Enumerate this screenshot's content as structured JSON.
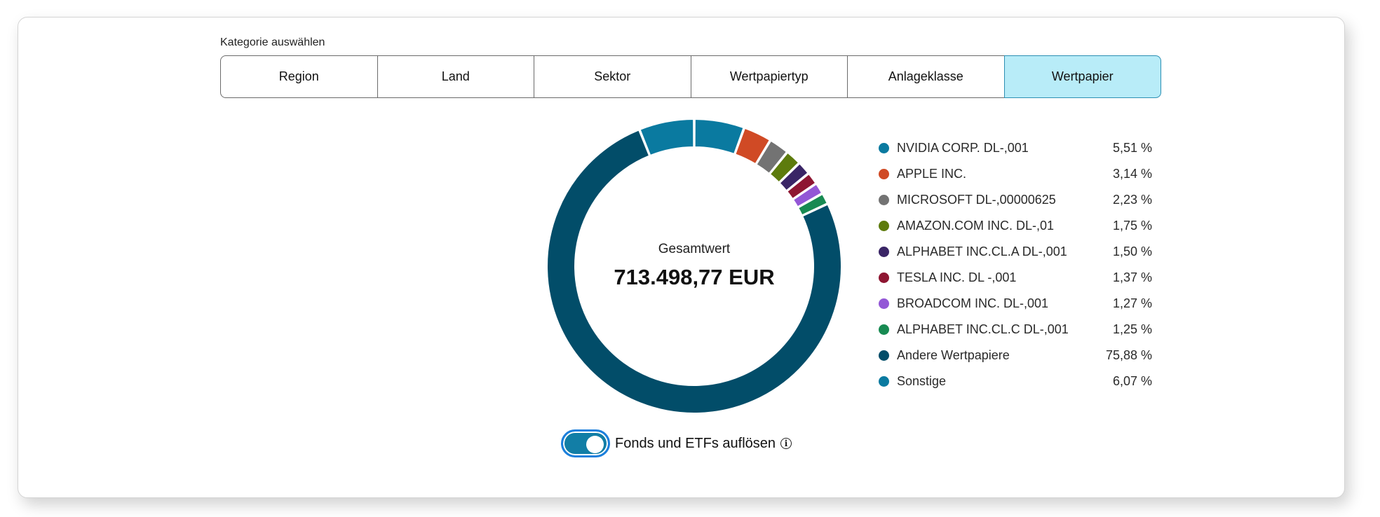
{
  "category": {
    "label": "Kategorie auswählen",
    "tabs": [
      "Region",
      "Land",
      "Sektor",
      "Wertpapiertyp",
      "Anlageklasse",
      "Wertpapier"
    ],
    "active_tab": "Wertpapier"
  },
  "center": {
    "label": "Gesamtwert",
    "value": "713.498,77 EUR"
  },
  "toggle": {
    "label": "Fonds und ETFs auflösen",
    "state": "on",
    "info_icon": "info-icon"
  },
  "chart_data": {
    "type": "pie",
    "donut": true,
    "start": "top",
    "direction": "clockwise",
    "slices": [
      {
        "name": "NVIDIA CORP. DL-,001",
        "value": 5.51,
        "label": "5,51 %",
        "color": "#0a7aa0"
      },
      {
        "name": "APPLE INC.",
        "value": 3.14,
        "label": "3,14 %",
        "color": "#d04a25"
      },
      {
        "name": "MICROSOFT DL-,00000625",
        "value": 2.23,
        "label": "2,23 %",
        "color": "#737373"
      },
      {
        "name": "AMAZON.COM INC. DL-,01",
        "value": 1.75,
        "label": "1,75 %",
        "color": "#5d7b0d"
      },
      {
        "name": "ALPHABET INC.CL.A DL-,001",
        "value": 1.5,
        "label": "1,50 %",
        "color": "#3a2566"
      },
      {
        "name": "TESLA INC. DL -,001",
        "value": 1.37,
        "label": "1,37 %",
        "color": "#8e1632"
      },
      {
        "name": "BROADCOM INC. DL-,001",
        "value": 1.27,
        "label": "1,27 %",
        "color": "#9357d6"
      },
      {
        "name": "ALPHABET INC.CL.C DL-,001",
        "value": 1.25,
        "label": "1,25 %",
        "color": "#178a52"
      },
      {
        "name": "Andere Wertpapiere",
        "value": 75.88,
        "label": "75,88 %",
        "color": "#024d69"
      },
      {
        "name": "Sonstige",
        "value": 6.07,
        "label": "6,07 %",
        "color": "#0a7aa0"
      }
    ]
  }
}
